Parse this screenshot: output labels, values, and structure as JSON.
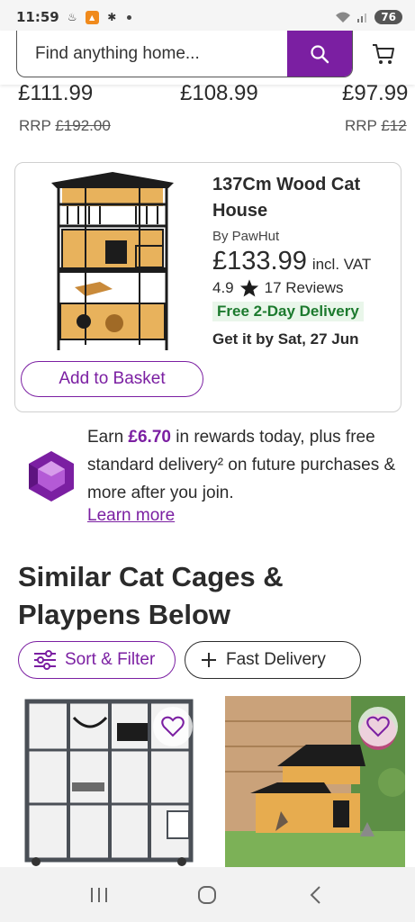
{
  "status_bar": {
    "time": "11:59",
    "battery": "76"
  },
  "search": {
    "placeholder": "Find anything home..."
  },
  "previous_row": {
    "prices": [
      "£111.99",
      "£108.99",
      "£97.99"
    ],
    "rrp_label": "RRP",
    "rrps": [
      "£192.00",
      "£12"
    ]
  },
  "product": {
    "title": "137Cm Wood Cat House",
    "brand": "By PawHut",
    "price": "£133.99",
    "price_note": "incl. VAT",
    "rating": "4.9",
    "reviews": "17 Reviews",
    "delivery_badge": "Free 2-Day Delivery",
    "get_it_by": "Get it by Sat, 27 Jun",
    "add_to_basket": "Add to Basket"
  },
  "rewards": {
    "text_before": "Earn ",
    "amount": "£6.70",
    "text_after": " in rewards today, plus free standard delivery² on future purchases & more after you join.",
    "learn_more": "Learn more"
  },
  "section": {
    "heading": "Similar Cat Cages & Playpens Below"
  },
  "filters": {
    "sort_filter": "Sort & Filter",
    "fast_delivery": "Fast Delivery"
  },
  "colors": {
    "brand_purple": "#7b1fa2",
    "delivery_green": "#1c7a2e",
    "delivery_bg": "#e9f6ea"
  },
  "icons": {
    "search": "search-icon",
    "cart": "cart-icon",
    "star": "star-icon",
    "gem": "gem-icon",
    "sliders": "sliders-icon",
    "plus": "plus-icon",
    "heart": "heart-icon"
  }
}
